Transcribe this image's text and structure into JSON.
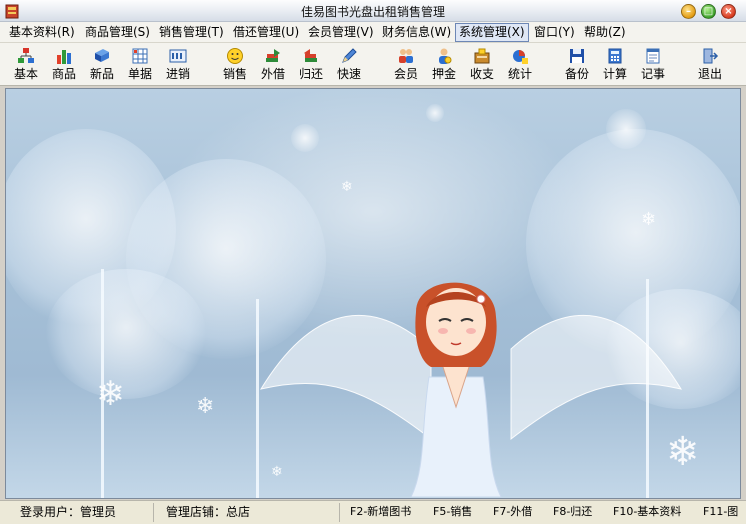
{
  "window": {
    "title": "佳易图书光盘出租销售管理"
  },
  "menu": {
    "items": [
      {
        "label": "基本资料(R)"
      },
      {
        "label": "商品管理(S)"
      },
      {
        "label": "销售管理(T)"
      },
      {
        "label": "借还管理(U)"
      },
      {
        "label": "会员管理(V)"
      },
      {
        "label": "财务信息(W)"
      },
      {
        "label": "系统管理(X)"
      },
      {
        "label": "窗口(Y)"
      },
      {
        "label": "帮助(Z)"
      }
    ],
    "active_index": 6
  },
  "toolbar": {
    "items": [
      {
        "label": "基本",
        "icon": "org-chart-icon"
      },
      {
        "label": "商品",
        "icon": "bar-chart-icon"
      },
      {
        "label": "新品",
        "icon": "blue-book-icon"
      },
      {
        "label": "单据",
        "icon": "grid-form-icon"
      },
      {
        "label": "进销",
        "icon": "ledger-icon"
      },
      {
        "label": "销售",
        "icon": "smiley-icon"
      },
      {
        "label": "外借",
        "icon": "books-out-icon"
      },
      {
        "label": "归还",
        "icon": "books-return-icon"
      },
      {
        "label": "快速",
        "icon": "pen-icon"
      },
      {
        "label": "会员",
        "icon": "members-icon"
      },
      {
        "label": "押金",
        "icon": "person-coin-icon"
      },
      {
        "label": "收支",
        "icon": "cash-box-icon"
      },
      {
        "label": "统计",
        "icon": "stats-icon"
      },
      {
        "label": "备份",
        "icon": "floppy-icon"
      },
      {
        "label": "计算",
        "icon": "calculator-icon"
      },
      {
        "label": "记事",
        "icon": "notepad-icon"
      },
      {
        "label": "退出",
        "icon": "exit-door-icon"
      }
    ]
  },
  "status": {
    "login_user": "登录用户：管理员",
    "store": "管理店铺：总店",
    "hotkeys": [
      "F2-新增图书",
      "F5-销售",
      "F7-外借",
      "F8-归还",
      "F10-基本资料",
      "F11-图"
    ]
  },
  "colors": {
    "chrome": "#f4f3ee",
    "active_menu_border": "#6d87b5",
    "canvas_sky": "#a7c1d8"
  }
}
